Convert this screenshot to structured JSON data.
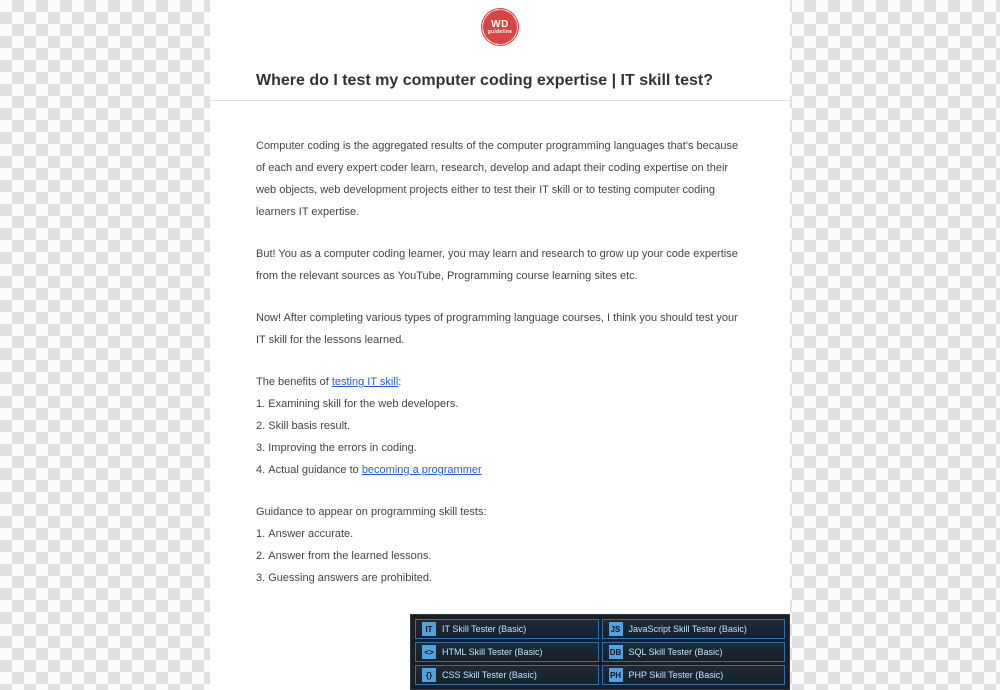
{
  "logo": {
    "line1": "WD",
    "line2": "guideline"
  },
  "title": "Where do I test my computer coding expertise | IT skill test?",
  "paragraphs": {
    "p1": "Computer coding is the aggregated results of the computer programming languages that's because of each and every expert coder learn, research, develop and adapt their coding expertise on their web objects, web development projects either to test their IT skill or to testing computer coding learners IT expertise.",
    "p2": "But! You as a computer coding learner, you may learn and research to grow up your code expertise from the relevant sources as YouTube, Programming course learning sites etc.",
    "p3": "Now! After completing various types of programming language courses, I think you should test your IT skill for the lessons learned."
  },
  "benefits": {
    "intro_prefix": "The benefits of ",
    "intro_link": "testing IT skill",
    "intro_suffix": ":",
    "items": {
      "b1": "Examining skill for the web developers.",
      "b2": "Skill basis result.",
      "b3": "Improving the errors in coding.",
      "b4_prefix": "Actual guidance to ",
      "b4_link": "becoming a programmer"
    }
  },
  "guidance": {
    "intro": "Guidance to appear on programming skill tests:",
    "items": {
      "g1": "Answer accurate.",
      "g2": "Answer from the learned lessons.",
      "g3": "Guessing answers are prohibited."
    }
  },
  "skill_panel": {
    "buttons": {
      "s0": "IT Skill Tester (Basic)",
      "s1": "JavaScript Skill Tester (Basic)",
      "s2": "HTML Skill Tester (Basic)",
      "s3": "SQL Skill Tester (Basic)",
      "s4": "CSS Skill Tester (Basic)",
      "s5": "PHP Skill Tester (Basic)"
    },
    "icons": {
      "s0": "IT",
      "s1": "JS",
      "s2": "<>",
      "s3": "DB",
      "s4": "{}",
      "s5": "PH"
    }
  }
}
